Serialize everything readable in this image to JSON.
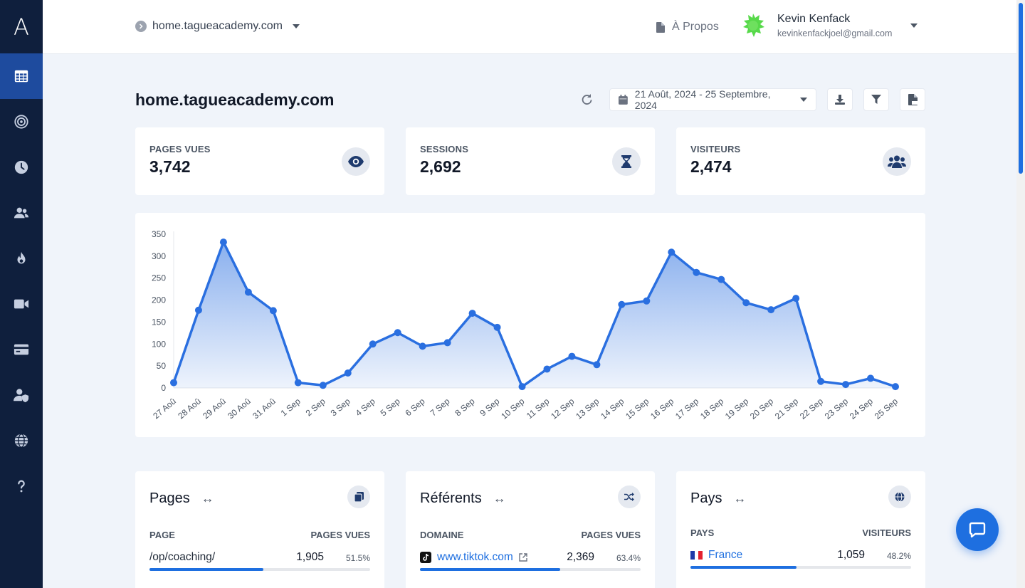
{
  "sidebar": {
    "logo": "A",
    "items": [
      {
        "icon": "table-icon",
        "active": true
      },
      {
        "icon": "target-icon",
        "active": false
      },
      {
        "icon": "clock-icon",
        "active": false
      },
      {
        "icon": "users-icon",
        "active": false
      },
      {
        "icon": "fire-icon",
        "active": false
      },
      {
        "icon": "video-icon",
        "active": false
      },
      {
        "icon": "card-icon",
        "active": false
      },
      {
        "icon": "user-shield-icon",
        "active": false
      },
      {
        "icon": "globe-icon",
        "active": false
      },
      {
        "icon": "help-icon",
        "active": false
      }
    ]
  },
  "topbar": {
    "site": "home.tagueacademy.com",
    "about": "À Propos",
    "user_name": "Kevin Kenfack",
    "user_email": "kevinkenfackjoel@gmail.com"
  },
  "header": {
    "title": "home.tagueacademy.com",
    "date_range": "21 Août, 2024 - 25 Septembre, 2024"
  },
  "stats": [
    {
      "label": "PAGES VUES",
      "value": "3,742",
      "icon": "eye-icon"
    },
    {
      "label": "SESSIONS",
      "value": "2,692",
      "icon": "hourglass-icon"
    },
    {
      "label": "VISITEURS",
      "value": "2,474",
      "icon": "users-icon"
    }
  ],
  "chart_data": {
    "type": "area",
    "title": "",
    "xlabel": "",
    "ylabel": "",
    "ylim": [
      0,
      350
    ],
    "yticks": [
      0,
      50,
      100,
      150,
      200,
      250,
      300,
      350
    ],
    "grid": false,
    "color": "#2a6fe0",
    "categories": [
      "27 Aoû",
      "28 Aoû",
      "29 Aoû",
      "30 Aoû",
      "31 Aoû",
      "1 Sep",
      "2 Sep",
      "3 Sep",
      "4 Sep",
      "5 Sep",
      "6 Sep",
      "7 Sep",
      "8 Sep",
      "9 Sep",
      "10 Sep",
      "11 Sep",
      "12 Sep",
      "13 Sep",
      "14 Sep",
      "15 Sep",
      "16 Sep",
      "17 Sep",
      "18 Sep",
      "19 Sep",
      "20 Sep",
      "21 Sep",
      "22 Sep",
      "23 Sep",
      "24 Sep",
      "25 Sep"
    ],
    "values": [
      12,
      177,
      332,
      218,
      176,
      12,
      6,
      34,
      100,
      126,
      95,
      103,
      170,
      138,
      3,
      43,
      72,
      53,
      190,
      198,
      309,
      263,
      247,
      194,
      178,
      204,
      15,
      8,
      22,
      3
    ]
  },
  "panels": {
    "pages": {
      "title": "Pages",
      "col1": "PAGE",
      "col2": "PAGES VUES",
      "rows": [
        {
          "name": "/op/coaching/",
          "value": "1,905",
          "pct": "51.5%",
          "fraction": 0.515
        }
      ]
    },
    "referents": {
      "title": "Référents",
      "col1": "DOMAINE",
      "col2": "PAGES VUES",
      "rows": [
        {
          "name": "www.tiktok.com",
          "value": "2,369",
          "pct": "63.4%",
          "fraction": 0.634
        }
      ]
    },
    "pays": {
      "title": "Pays",
      "col1": "PAYS",
      "col2": "VISITEURS",
      "rows": [
        {
          "name": "France",
          "value": "1,059",
          "pct": "48.2%",
          "fraction": 0.482
        }
      ]
    }
  }
}
